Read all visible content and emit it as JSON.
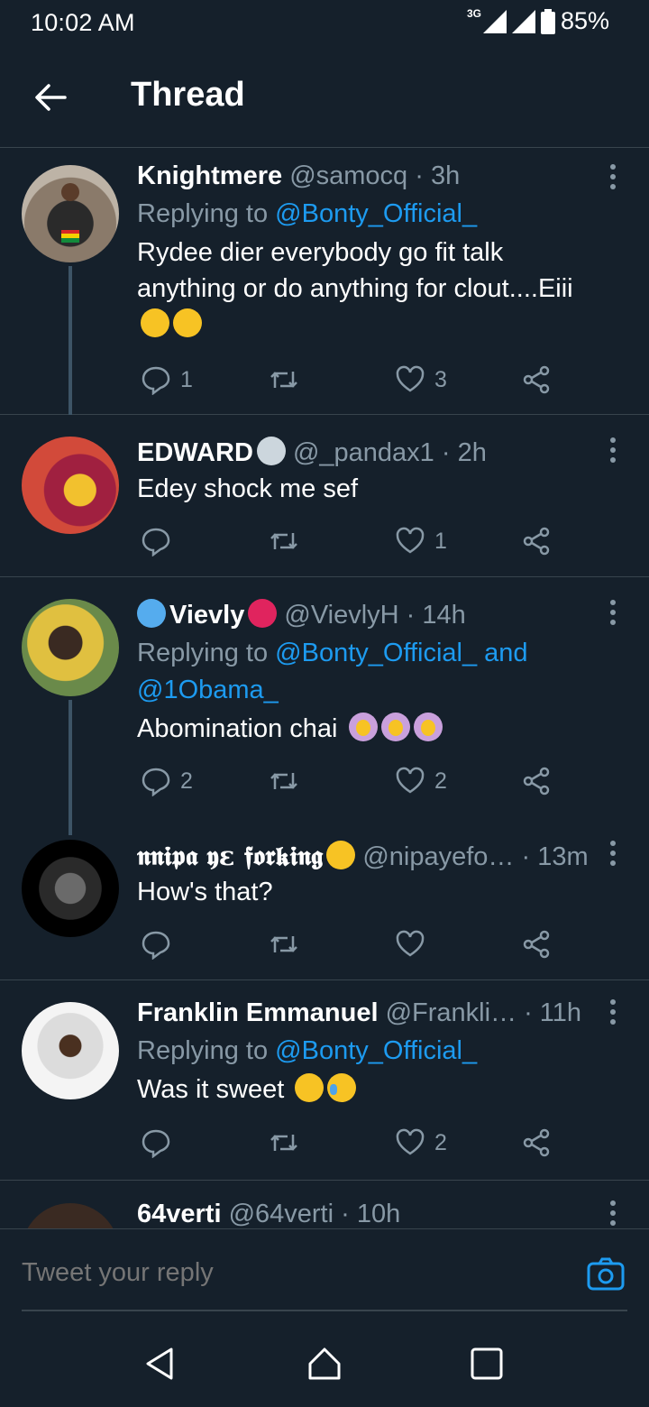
{
  "status_bar": {
    "time": "10:02 AM",
    "network": "3G",
    "battery": "85%"
  },
  "header": {
    "title": "Thread"
  },
  "tweets": [
    {
      "name": "Knightmere",
      "handle": "@samocq",
      "time": "· 3h",
      "replying_prefix": "Replying to ",
      "replying_to": "@Bonty_Official_",
      "text": "Rydee dier everybody go fit talk anything or do anything for clout....Eiii",
      "emojis": [
        "confused-face",
        "confused-face"
      ],
      "replies": "1",
      "retweets": "",
      "likes": "3"
    },
    {
      "name": "EDWARD",
      "name_emoji": "alien",
      "handle": "@_pandax1",
      "time": "· 2h",
      "text": "Edey shock me sef",
      "replies": "",
      "retweets": "",
      "likes": "1"
    },
    {
      "name_prefix_emoji": "butterfly",
      "name": "Vievly",
      "name_emoji": "heart",
      "handle": "@VievlyH",
      "time": "· 14h",
      "replying_prefix": "Replying to ",
      "replying_to": "@Bonty_Official_ and @1Obama_",
      "text": "Abomination chai",
      "emojis": [
        "face-palm",
        "face-palm",
        "face-palm"
      ],
      "replies": "2",
      "retweets": "",
      "likes": "2"
    },
    {
      "name": "𝖓𝖓𝖎𝖕𝖆 𝖞ɛ 𝖋𝖔𝖗𝖐𝖎𝖓𝖌",
      "name_emoji": "eye-roll",
      "handle": "@nipayefo…",
      "time": "· 13m",
      "text": "How's that?",
      "replies": "",
      "retweets": "",
      "likes": ""
    },
    {
      "name": "Franklin Emmanuel",
      "handle": "@Frankli…",
      "time": "· 11h",
      "replying_prefix": "Replying to ",
      "replying_to": "@Bonty_Official_",
      "text": "Was it sweet",
      "emojis": [
        "thinking-face",
        "laughing-tears"
      ],
      "replies": "",
      "retweets": "",
      "likes": "2"
    },
    {
      "name": "64verti",
      "handle": "@64verti",
      "time": "· 10h"
    }
  ],
  "reply_bar": {
    "placeholder": "Tweet your reply"
  },
  "colors": {
    "background": "#15202b",
    "accent": "#1d9bf0",
    "muted": "#8899a6",
    "divider": "#38444d"
  }
}
